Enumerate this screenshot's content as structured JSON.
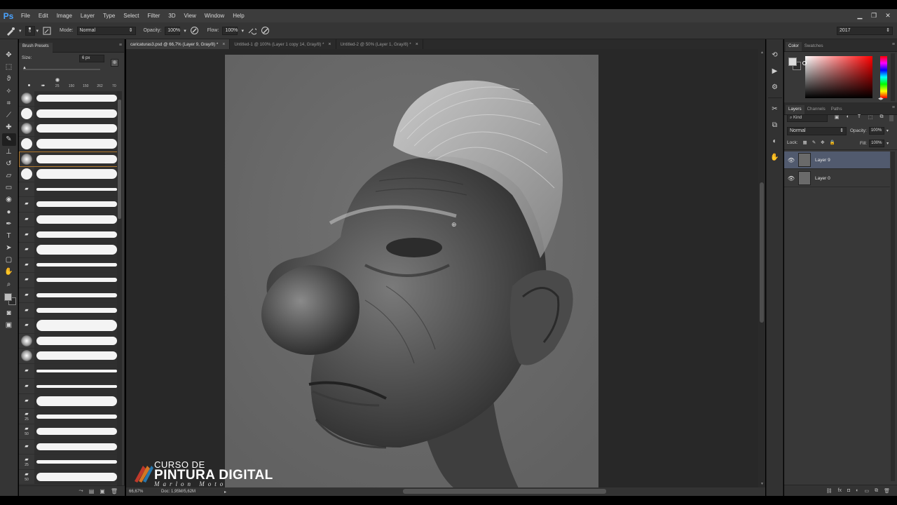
{
  "app": {
    "logo": "Ps",
    "menu": [
      "File",
      "Edit",
      "Image",
      "Layer",
      "Type",
      "Select",
      "Filter",
      "3D",
      "View",
      "Window",
      "Help"
    ],
    "window_controls": [
      "minimize-icon",
      "restore-icon",
      "close-icon"
    ]
  },
  "options": {
    "brush_size": "6",
    "mode_label": "Mode:",
    "mode_value": "Normal",
    "opacity_label": "Opacity:",
    "opacity_value": "100%",
    "flow_label": "Flow:",
    "flow_value": "100%",
    "workspace": "2017"
  },
  "toolbar": {
    "tools": [
      "move-tool-icon",
      "marquee-tool-icon",
      "lasso-tool-icon",
      "magic-wand-tool-icon",
      "crop-tool-icon",
      "eyedropper-tool-icon",
      "healing-brush-tool-icon",
      "brush-tool-icon",
      "clone-stamp-tool-icon",
      "history-brush-tool-icon",
      "eraser-tool-icon",
      "gradient-tool-icon",
      "blur-tool-icon",
      "dodge-tool-icon",
      "pen-tool-icon",
      "type-tool-icon",
      "path-selection-tool-icon",
      "shape-tool-icon",
      "hand-tool-icon",
      "zoom-tool-icon"
    ],
    "active_tool": "brush-tool-icon",
    "foreground_color": "#bdbdbd",
    "background_color": "#2a2a2a"
  },
  "brush_presets": {
    "tab": "Brush Presets",
    "size_label": "Size:",
    "size_value": "6 px",
    "quick_sizes": [
      "25",
      "150",
      "150",
      "262",
      "70"
    ],
    "items": [
      {
        "thumb": "soft",
        "num": "",
        "stroke": 10
      },
      {
        "thumb": "hard",
        "num": "",
        "stroke": 12
      },
      {
        "thumb": "soft",
        "num": "",
        "stroke": 12
      },
      {
        "thumb": "hard",
        "num": "",
        "stroke": 14
      },
      {
        "thumb": "soft",
        "num": "",
        "stroke": 12,
        "selected": true
      },
      {
        "thumb": "hard",
        "num": "",
        "stroke": 14
      },
      {
        "thumb": "icon",
        "num": "",
        "stroke": 4
      },
      {
        "thumb": "icon",
        "num": "",
        "stroke": 8
      },
      {
        "thumb": "icon",
        "num": "",
        "stroke": 12
      },
      {
        "thumb": "icon",
        "num": "",
        "stroke": 9
      },
      {
        "thumb": "icon",
        "num": "",
        "stroke": 14
      },
      {
        "thumb": "icon",
        "num": "",
        "stroke": 5
      },
      {
        "thumb": "icon",
        "num": "",
        "stroke": 6
      },
      {
        "thumb": "icon",
        "num": "",
        "stroke": 6
      },
      {
        "thumb": "icon",
        "num": "",
        "stroke": 7
      },
      {
        "thumb": "icon",
        "num": "",
        "stroke": 16
      },
      {
        "thumb": "soft",
        "num": "",
        "stroke": 12
      },
      {
        "thumb": "soft",
        "num": "",
        "stroke": 12
      },
      {
        "thumb": "icon",
        "num": "",
        "stroke": 4
      },
      {
        "thumb": "icon",
        "num": "",
        "stroke": 4
      },
      {
        "thumb": "icon",
        "num": "",
        "stroke": 14
      },
      {
        "thumb": "icon",
        "num": "25",
        "stroke": 6
      },
      {
        "thumb": "icon",
        "num": "50",
        "stroke": 10
      },
      {
        "thumb": "icon",
        "num": "",
        "stroke": 10
      },
      {
        "thumb": "icon",
        "num": "25",
        "stroke": 5
      },
      {
        "thumb": "icon",
        "num": "50",
        "stroke": 12
      }
    ]
  },
  "tabs": [
    {
      "label": "caricaturas3.psd @ 66,7% (Layer 9, Gray/8) *",
      "active": true
    },
    {
      "label": "Untitled-1 @ 100% (Layer 1 copy 14, Gray/8) *",
      "active": false
    },
    {
      "label": "Untitled-2 @ 50% (Layer 1, Gray/8) *",
      "active": false
    }
  ],
  "watermark": {
    "line1": "CURSO DE",
    "line2": "PINTURA DIGITAL",
    "line3": "Marlon Moto"
  },
  "status": {
    "zoom": "66,67%",
    "doc": "Doc: 1,95M/5,62M"
  },
  "mid_strip": [
    "history-icon",
    "play-actions-icon",
    "properties-icon",
    "tool-presets-icon",
    "clone-source-icon",
    "adjustments-icon",
    "puppet-icon"
  ],
  "color_panel": {
    "tabs": [
      "Color",
      "Swatches"
    ],
    "fg": "#dcdcdc",
    "bg": "#2a2a2a"
  },
  "layers_panel": {
    "tabs": [
      "Layers",
      "Channels",
      "Paths"
    ],
    "kind_label": "Kind",
    "blend_mode": "Normal",
    "opacity_label": "Opacity:",
    "opacity_value": "100%",
    "lock_label": "Lock:",
    "fill_label": "Fill:",
    "fill_value": "100%",
    "layers": [
      {
        "name": "Layer 9",
        "selected": true
      },
      {
        "name": "Layer 0",
        "selected": false
      }
    ],
    "footer_icons": [
      "link-layers-icon",
      "fx-icon",
      "add-mask-icon",
      "adjustment-layer-icon",
      "new-group-icon",
      "new-layer-icon",
      "delete-layer-icon"
    ]
  }
}
